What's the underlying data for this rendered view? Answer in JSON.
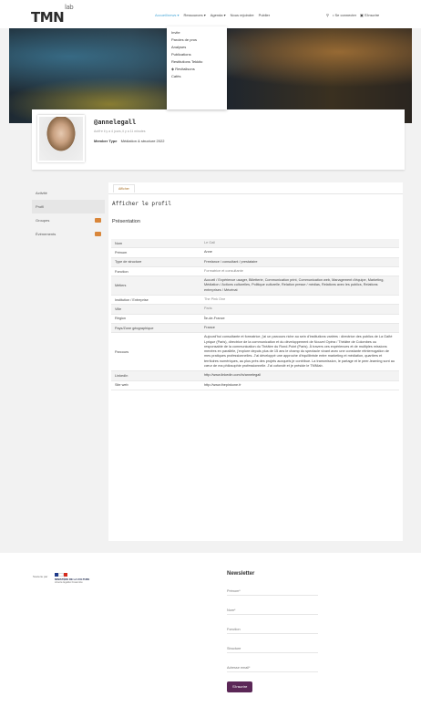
{
  "header": {
    "logo": "TMN",
    "logo_sup": "lab",
    "nav": [
      {
        "label": "Accueil/news ▾",
        "active": true
      },
      {
        "label": "Ressources ▾",
        "active": false
      },
      {
        "label": "Agenda ▾",
        "active": false
      },
      {
        "label": "Nous rejoindre",
        "active": false
      },
      {
        "label": "Publier",
        "active": false
      }
    ],
    "search_icon": "⚲",
    "login_label": "• Se connecter",
    "register_label": "▣ S'inscrire",
    "dropdown": [
      "Invite",
      "Paroles de pros",
      "Analyses",
      "Publications",
      "Restitutions Tekkito",
      "◈ Revitalisons",
      "Cafés"
    ]
  },
  "profile": {
    "username": "@annelegall",
    "joined": "Actif·e il y a 4 jours, il y a 11 minutes",
    "member_type_label": "Member Type",
    "member_type_value": "Médiation & structure 2022"
  },
  "sidenav": [
    {
      "label": "Activité",
      "badge": false,
      "active": false
    },
    {
      "label": "Profil",
      "badge": true,
      "active": true
    },
    {
      "label": "Groupes",
      "badge": true,
      "active": false
    },
    {
      "label": "Événements",
      "badge": true,
      "active": false
    }
  ],
  "panel": {
    "tab": "Afficher",
    "view_title": "Afficher le profil",
    "section_title": "Présentation",
    "rows": [
      {
        "k": "Nom",
        "v": "Le Gall",
        "muted": true
      },
      {
        "k": "Prénom",
        "v": "Anne",
        "muted": false
      },
      {
        "k": "Type de structure",
        "v": "Freelance / consultant / prestataire",
        "muted": false
      },
      {
        "k": "Fonction",
        "v": "Formatrice et consultante",
        "muted": true
      },
      {
        "k": "Métiers",
        "v": "Accueil / Expérience usager, Billetterie, Communication print, Communication web, Management d'équipe, Marketing, Médiation / Actions culturelles, Politique culturelle, Relation presse / médias, Relations avec les publics, Relations entreprises / Mécénat",
        "muted": false
      },
      {
        "k": "Institution / Entreprise",
        "v": "The Pink One",
        "muted": true
      },
      {
        "k": "Ville",
        "v": "Paris",
        "muted": true
      },
      {
        "k": "Région",
        "v": "Île-de-France",
        "muted": false
      },
      {
        "k": "Pays/Zone géographique",
        "v": "France",
        "muted": false
      },
      {
        "k": "Parcours",
        "v": "Aujourd'hui consultante et formatrice, j'ai un parcours riche au sein d'institutions variées : directrice des publics de La Gaîté Lyrique (Paris), directrice de la communication et du développement de Nouvel Opéra / Théâtre de Colombes ou responsable de la communication du Théâtre du Rond-Point (Paris). À travers ces expériences et de multiples missions menées en parallèle, j'explore depuis plus de 15 ans le champ du spectacle vivant avec une constante réinterrogation de mes pratiques professionnelles. J'ai développé une approche d'équilibriste entre marketing et médiation, quartiers et territoires numériques, au plus près des projets auxquels je contribue. La transmission, le partage et le peer-learning sont au cœur de ma philosophie professionnelle. J'ai cofondé et je préside le TMNlab.",
        "muted": false
      },
      {
        "k": "LinkedIn",
        "v": "http://www.linkedin.com/in/annelegall",
        "muted": false
      },
      {
        "k": "Site web",
        "v": "http://www.thepinkone.fr",
        "muted": false
      }
    ]
  },
  "footer": {
    "partner_label": "Soutenu par",
    "ministry_text": "MINISTÈRE DE LA CULTURE",
    "ministry_sub": "Liberté Égalité Fraternité",
    "newsletter_title": "Newsletter",
    "fields": [
      "Prénom*",
      "Nom*",
      "Fonction",
      "Structure",
      "Adresse email*"
    ],
    "subscribe_label": "S'inscrire"
  }
}
